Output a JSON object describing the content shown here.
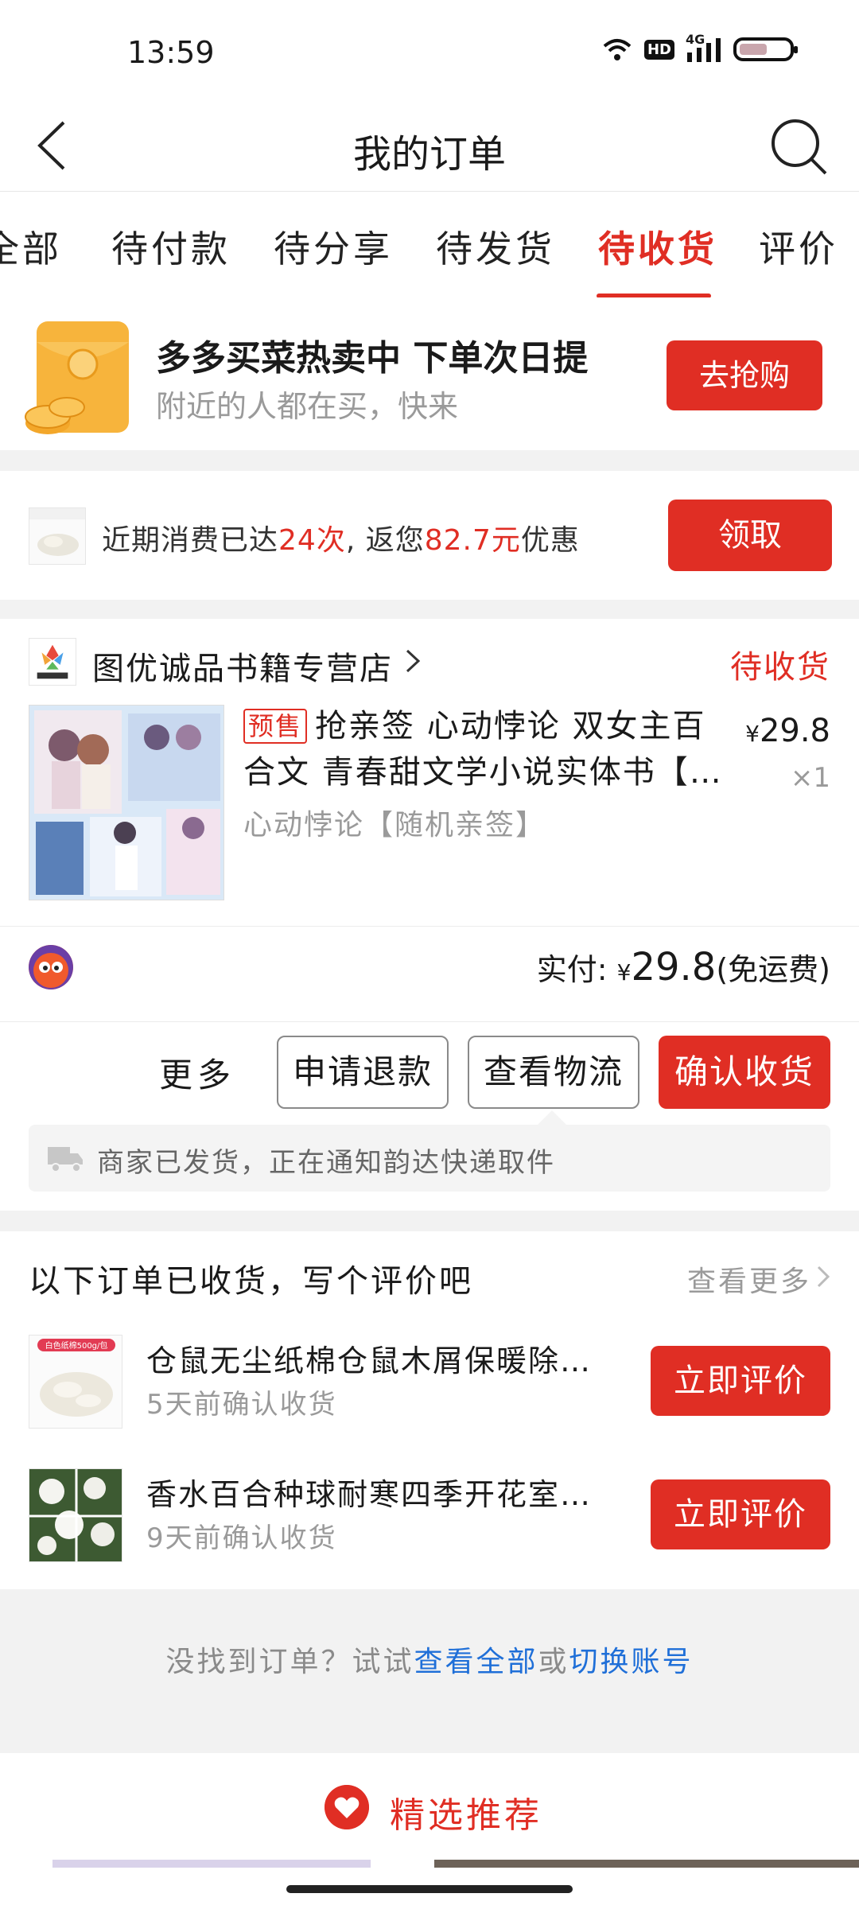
{
  "status_bar": {
    "time": "13:59",
    "hd": "HD",
    "network": "4G"
  },
  "nav": {
    "title": "我的订单",
    "back_icon": "chevron-left-icon",
    "search_icon": "search-icon"
  },
  "tabs": [
    {
      "label": "全部",
      "active": false
    },
    {
      "label": "待付款",
      "active": false
    },
    {
      "label": "待分享",
      "active": false
    },
    {
      "label": "待发货",
      "active": false
    },
    {
      "label": "待收货",
      "active": true
    },
    {
      "label": "评价",
      "active": false
    }
  ],
  "promo": {
    "title": "多多买菜热卖中 下单次日提",
    "subtitle": "附近的人都在买，快来",
    "button": "去抢购"
  },
  "spend": {
    "prefix": "近期消费已达",
    "count": "24次",
    "middle": ", 返您",
    "amount": "82.7元",
    "suffix": "优惠",
    "button": "领取"
  },
  "order": {
    "store_name": "图优诚品书籍专营店",
    "status": "待收货",
    "presale_tag": "预售",
    "product_title": "抢亲签 心动悖论 双女主百合文 青春甜文学小说实体书【…",
    "variant": "心动悖论【随机亲签】",
    "price_symbol": "¥",
    "price": "29.8",
    "quantity": "×1",
    "paid_label": "实付: ",
    "paid_symbol": "¥",
    "paid_amount": "29.8",
    "paid_note": "(免运费)",
    "actions": {
      "more": "更多",
      "refund": "申请退款",
      "logistics": "查看物流",
      "confirm": "确认收货"
    },
    "logistics_tip": "商家已发货，正在通知韵达快递取件"
  },
  "review": {
    "heading": "以下订单已收货，写个评价吧",
    "more": "查看更多",
    "items": [
      {
        "title": "仓鼠无尘纸棉仓鼠木屑保暖除臭垫料",
        "sub": "5天前确认收货",
        "button": "立即评价",
        "thumb_label": "白色纸棉500g/包"
      },
      {
        "title": "香水百合种球耐寒四季开花室内盆栽",
        "sub": "9天前确认收货",
        "button": "立即评价"
      }
    ]
  },
  "not_found": {
    "prefix": "没找到订单？试试",
    "link1": "查看全部",
    "middle": "或",
    "link2": "切换账号"
  },
  "recommend": {
    "label": "精选推荐"
  },
  "colors": {
    "accent": "#e02e24",
    "link": "#1f6fd8"
  }
}
